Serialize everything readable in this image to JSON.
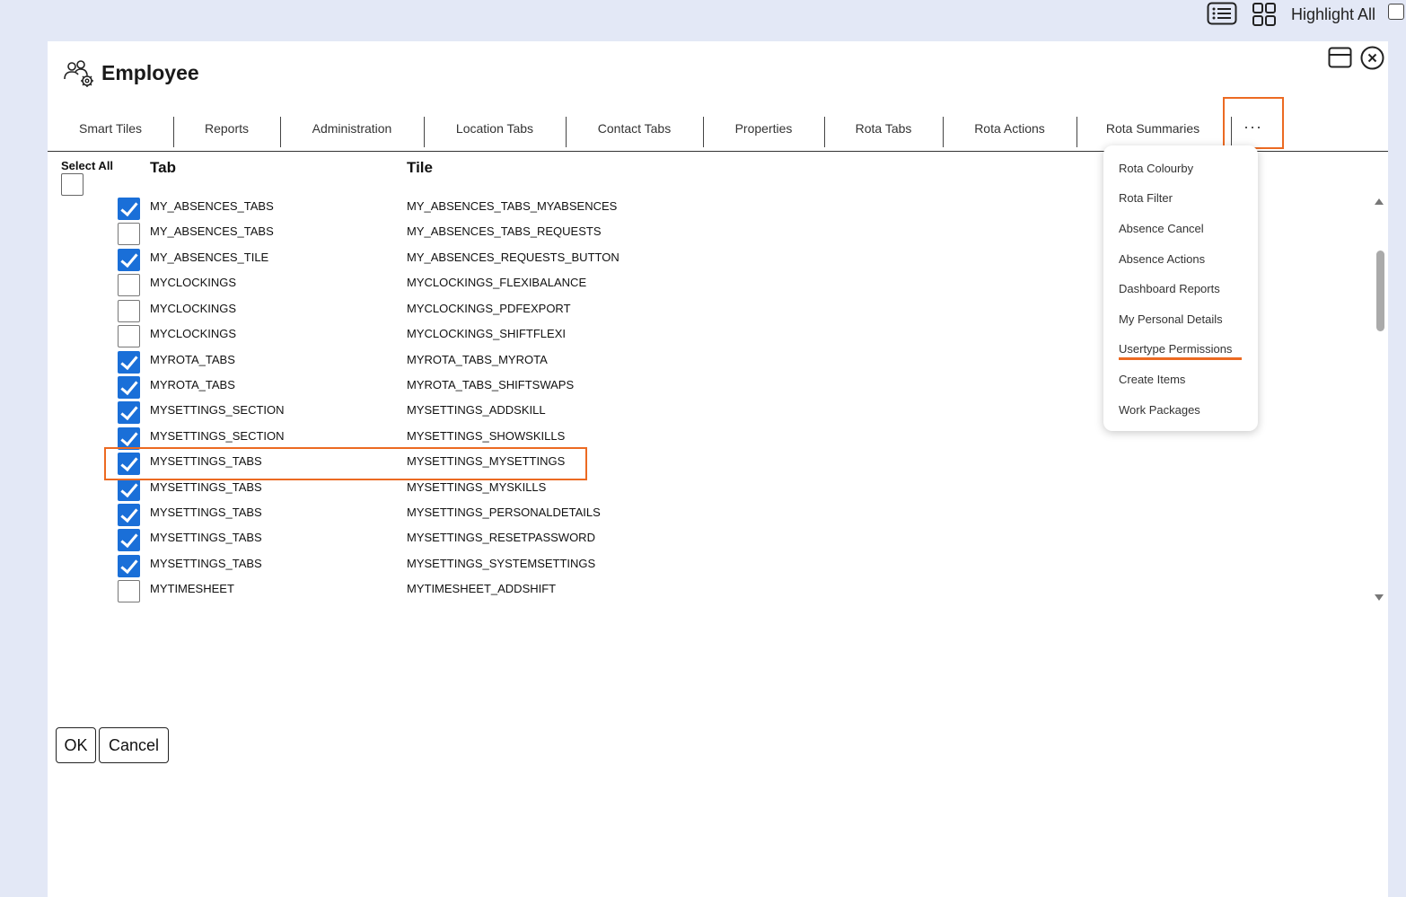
{
  "toolbar": {
    "list_icon": "list-view-icon",
    "grid_icon": "grid-view-icon",
    "highlight_label": "Highlight All",
    "highlight_checked": false
  },
  "dialog": {
    "title": "Employee",
    "title_icon": "users-settings-icon",
    "tabs": [
      "Smart Tiles",
      "Reports",
      "Administration",
      "Location Tabs",
      "Contact Tabs",
      "Properties",
      "Rota Tabs",
      "Rota Actions",
      "Rota Summaries"
    ],
    "more_label": "...",
    "select_all_label": "Select All",
    "columns": {
      "tab": "Tab",
      "tile": "Tile"
    },
    "rows": [
      {
        "tab": "MY_ABSENCES_TABS",
        "tile": "MY_ABSENCES_TABS_MYABSENCES",
        "checked": true
      },
      {
        "tab": "MY_ABSENCES_TABS",
        "tile": "MY_ABSENCES_TABS_REQUESTS",
        "checked": false
      },
      {
        "tab": "MY_ABSENCES_TILE",
        "tile": "MY_ABSENCES_REQUESTS_BUTTON",
        "checked": true
      },
      {
        "tab": "MYCLOCKINGS",
        "tile": "MYCLOCKINGS_FLEXIBALANCE",
        "checked": false
      },
      {
        "tab": "MYCLOCKINGS",
        "tile": "MYCLOCKINGS_PDFEXPORT",
        "checked": false
      },
      {
        "tab": "MYCLOCKINGS",
        "tile": "MYCLOCKINGS_SHIFTFLEXI",
        "checked": false
      },
      {
        "tab": "MYROTA_TABS",
        "tile": "MYROTA_TABS_MYROTA",
        "checked": true
      },
      {
        "tab": "MYROTA_TABS",
        "tile": "MYROTA_TABS_SHIFTSWAPS",
        "checked": true
      },
      {
        "tab": "MYSETTINGS_SECTION",
        "tile": "MYSETTINGS_ADDSKILL",
        "checked": true
      },
      {
        "tab": "MYSETTINGS_SECTION",
        "tile": "MYSETTINGS_SHOWSKILLS",
        "checked": true
      },
      {
        "tab": "MYSETTINGS_TABS",
        "tile": "MYSETTINGS_MYSETTINGS",
        "checked": true
      },
      {
        "tab": "MYSETTINGS_TABS",
        "tile": "MYSETTINGS_MYSKILLS",
        "checked": true
      },
      {
        "tab": "MYSETTINGS_TABS",
        "tile": "MYSETTINGS_PERSONALDETAILS",
        "checked": true
      },
      {
        "tab": "MYSETTINGS_TABS",
        "tile": "MYSETTINGS_RESETPASSWORD",
        "checked": true
      },
      {
        "tab": "MYSETTINGS_TABS",
        "tile": "MYSETTINGS_SYSTEMSETTINGS",
        "checked": true
      },
      {
        "tab": "MYTIMESHEET",
        "tile": "MYTIMESHEET_ADDSHIFT",
        "checked": false
      }
    ],
    "ok_label": "OK",
    "cancel_label": "Cancel"
  },
  "menu": {
    "items": [
      "Rota Colourby",
      "Rota Filter",
      "Absence Cancel",
      "Absence Actions",
      "Dashboard Reports",
      "My Personal Details",
      "Usertype Permissions",
      "Create Items",
      "Work Packages"
    ],
    "underlined_item": "Usertype Permissions"
  },
  "colors": {
    "accent_highlight": "#ec6a22",
    "checkbox_checked": "#1a6fd8",
    "page_background": "#e3e8f6"
  }
}
